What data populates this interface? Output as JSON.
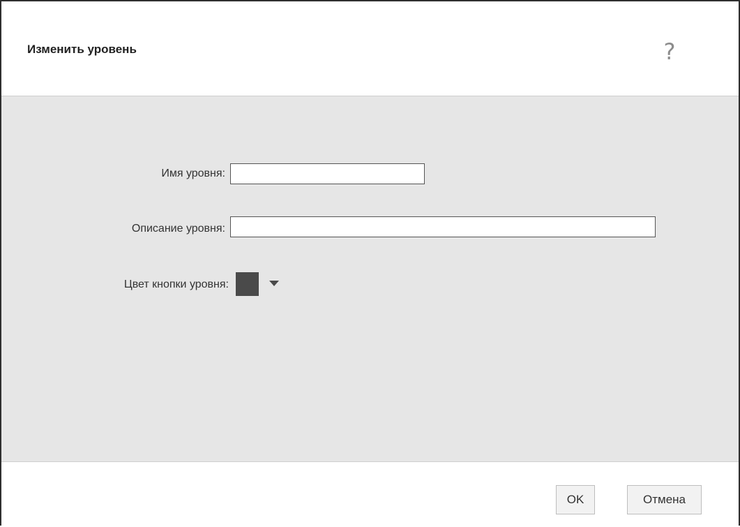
{
  "dialog": {
    "title": "Изменить уровень",
    "help_icon": "?",
    "icons": {
      "help": "question-mark-icon",
      "dropdown": "triangle-down-icon"
    }
  },
  "form": {
    "name_label": "Имя уровня:",
    "name_value": "",
    "description_label": "Описание уровня:",
    "description_value": "",
    "color_label": "Цвет кнопки уровня:",
    "color_value": "#4a4a4a"
  },
  "buttons": {
    "ok_label": "OK",
    "cancel_label": "Отмена"
  },
  "colors": {
    "body_background": "#e6e6e6",
    "header_background": "#ffffff",
    "swatch": "#4a4a4a"
  }
}
